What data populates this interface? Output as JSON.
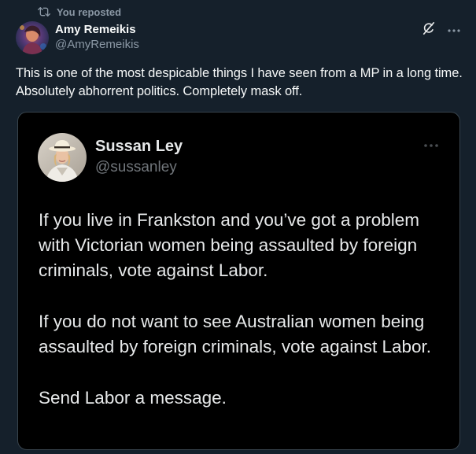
{
  "repost": {
    "label": "You reposted",
    "icon": "repost-icon"
  },
  "post": {
    "author_name": "Amy Remeikis",
    "author_handle": "@AmyRemeikis",
    "avatar_icon": "avatar",
    "actions": [
      {
        "icon": "grok-icon"
      },
      {
        "icon": "more-options-icon"
      }
    ],
    "text": "This is one of the most despicable things I have seen from a MP in a long time.  Absolutely abhorrent politics. Completely mask off."
  },
  "quoted": {
    "author_name": "Sussan Ley",
    "author_handle": "@sussanley",
    "avatar_icon": "avatar",
    "more_icon": "more-options-icon",
    "paragraphs": [
      "If you live in Frankston and you’ve got a problem with Victorian women being assaulted by foreign criminals, vote against Labor.",
      "If you do not want to see Australian women being assaulted by foreign criminals, vote against Labor.",
      "Send Labor a message."
    ]
  },
  "colors": {
    "background": "#15202b",
    "card_background": "#000000",
    "card_border": "#38444d",
    "primary_text": "#f7f9f9",
    "secondary_text": "#8b98a5"
  }
}
